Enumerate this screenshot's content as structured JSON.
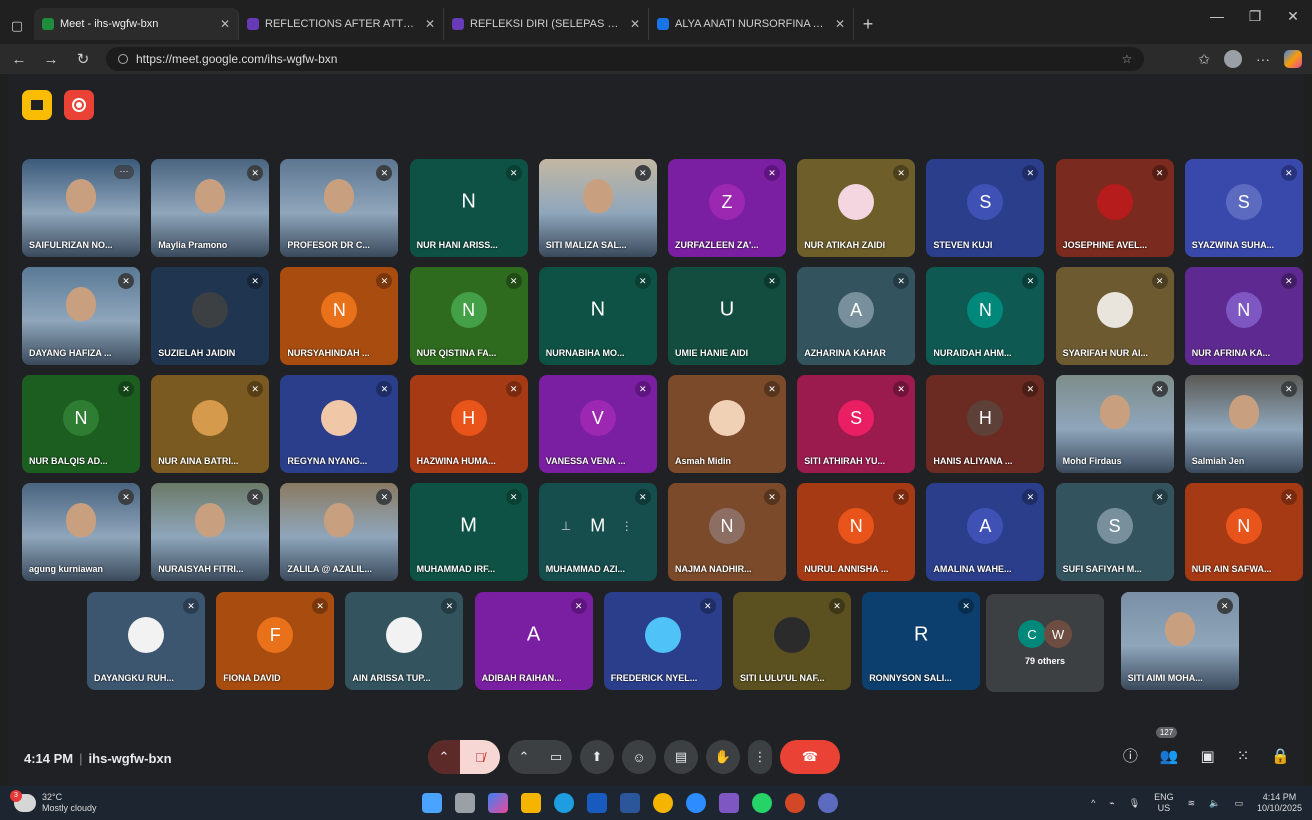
{
  "browser": {
    "tabs": [
      {
        "title": "Meet - ihs-wgfw-bxn",
        "active": true,
        "color": "#1e8e3e"
      },
      {
        "title": "REFLECTIONS AFTER ATTENDING",
        "active": false,
        "color": "#673ab7"
      },
      {
        "title": "REFLEKSI DIRI (SELEPAS MENGHA",
        "active": false,
        "color": "#673ab7"
      },
      {
        "title": "ALYA ANATI NURSORFINA ABDUL",
        "active": false,
        "color": "#1a73e8"
      }
    ],
    "url": "https://meet.google.com/ihs-wgfw-bxn"
  },
  "participants": [
    {
      "name": "SAIFULRIZAN NO...",
      "initial": "",
      "bg": "#3b5a7a",
      "type": "photo",
      "mic": "more",
      "micColor": "#3c4043"
    },
    {
      "name": "Maylia Pramono",
      "initial": "",
      "bg": "#4a6480",
      "type": "photo",
      "mic": "off",
      "micColor": "#3c4043"
    },
    {
      "name": "PROFESOR DR C...",
      "initial": "",
      "bg": "#5d7691",
      "type": "photo",
      "mic": "off",
      "micColor": "#3c4043"
    },
    {
      "name": "NUR HANI ARISS...",
      "initial": "N",
      "bg": "#0d5244",
      "type": "letter",
      "mic": "off",
      "micColor": "#0a3f34"
    },
    {
      "name": "SITI MALIZA SAL...",
      "initial": "",
      "bg": "#c3b7a3",
      "type": "photo",
      "mic": "off",
      "micColor": "#3c4043"
    },
    {
      "name": "ZURFAZLEEN ZA'...",
      "initial": "Z",
      "bg": "#7b1fa2",
      "type": "avatar",
      "avatarBg": "#9c27b0",
      "mic": "off",
      "micColor": "#5e1580"
    },
    {
      "name": "NUR ATIKAH ZAIDI",
      "initial": "",
      "bg": "#6d5e2a",
      "type": "avatar",
      "avatarBg": "#f3d6e0",
      "mic": "off",
      "micColor": "#4c411c"
    },
    {
      "name": "STEVEN KUJI",
      "initial": "S",
      "bg": "#2b3e8c",
      "type": "avatar",
      "avatarBg": "#3f51b5",
      "mic": "off",
      "micColor": "#1f2d66"
    },
    {
      "name": "JOSEPHINE AVEL...",
      "initial": "",
      "bg": "#7a2a1e",
      "type": "avatar",
      "avatarBg": "#b71c1c",
      "mic": "off",
      "micColor": "#561d15"
    },
    {
      "name": "SYAZWINA SUHA...",
      "initial": "S",
      "bg": "#3949ab",
      "type": "avatar",
      "avatarBg": "#5c6bc0",
      "mic": "off",
      "micColor": "#283380"
    },
    {
      "name": "DAYANG HAFIZA ...",
      "initial": "",
      "bg": "#5a7a96",
      "type": "photo",
      "mic": "off",
      "micColor": "#3c4043"
    },
    {
      "name": "SUZIELAH JAIDIN",
      "initial": "",
      "bg": "#1f3550",
      "type": "avatar",
      "avatarBg": "#3c4043",
      "mic": "off",
      "micColor": "#162638"
    },
    {
      "name": "NURSYAHINDAH ...",
      "initial": "N",
      "bg": "#a84c10",
      "type": "avatar",
      "avatarBg": "#e8711a",
      "mic": "off",
      "micColor": "#7a370c"
    },
    {
      "name": "NUR QISTINA FA...",
      "initial": "N",
      "bg": "#2e6b1e",
      "type": "avatar",
      "avatarBg": "#43a047",
      "mic": "off",
      "micColor": "#204b15"
    },
    {
      "name": "NURNABIHA MO...",
      "initial": "N",
      "bg": "#0d5244",
      "type": "letter",
      "mic": "off",
      "micColor": "#0a3f34"
    },
    {
      "name": "UMIE HANIE AIDI",
      "initial": "U",
      "bg": "#124d3f",
      "type": "letter",
      "mic": "off",
      "micColor": "#0c392e"
    },
    {
      "name": "AZHARINA KAHAR",
      "initial": "A",
      "bg": "#33545f",
      "type": "avatar",
      "avatarBg": "#78909c",
      "mic": "off",
      "micColor": "#233b43"
    },
    {
      "name": "NURAIDAH AHM...",
      "initial": "N",
      "bg": "#0f5953",
      "type": "avatar",
      "avatarBg": "#00897b",
      "mic": "off",
      "micColor": "#0a3f3b"
    },
    {
      "name": "SYARIFAH NUR AI...",
      "initial": "",
      "bg": "#6d5a30",
      "type": "avatar",
      "avatarBg": "#e9e4dc",
      "mic": "off",
      "micColor": "#4d3f22"
    },
    {
      "name": "NUR AFRINA KA...",
      "initial": "N",
      "bg": "#5e2a91",
      "type": "avatar",
      "avatarBg": "#7e57c2",
      "mic": "off",
      "micColor": "#431e67"
    },
    {
      "name": "NUR BALQIS AD...",
      "initial": "N",
      "bg": "#1b5e20",
      "type": "avatar",
      "avatarBg": "#2e7d32",
      "mic": "off",
      "micColor": "#134417"
    },
    {
      "name": "NUR AINA BATRI...",
      "initial": "",
      "bg": "#7a5a20",
      "type": "avatar",
      "avatarBg": "#d59a4c",
      "mic": "off",
      "micColor": "#563f17"
    },
    {
      "name": "REGYNA NYANG...",
      "initial": "",
      "bg": "#2b3e8c",
      "type": "avatar",
      "avatarBg": "#f0c8a8",
      "mic": "off",
      "micColor": "#1f2d66"
    },
    {
      "name": "HAZWINA HUMA...",
      "initial": "H",
      "bg": "#a63a14",
      "type": "avatar",
      "avatarBg": "#e8541a",
      "mic": "off",
      "micColor": "#7a2b0f"
    },
    {
      "name": "VANESSA VENA ...",
      "initial": "V",
      "bg": "#7b1fa2",
      "type": "avatar",
      "avatarBg": "#9c27b0",
      "mic": "off",
      "micColor": "#5e1580"
    },
    {
      "name": "Asmah Midin",
      "initial": "",
      "bg": "#7a4a2a",
      "type": "avatar",
      "avatarBg": "#f1d1b6",
      "mic": "off",
      "micColor": "#56341e"
    },
    {
      "name": "SITI ATHIRAH YU...",
      "initial": "S",
      "bg": "#9c1b4f",
      "type": "avatar",
      "avatarBg": "#e91e63",
      "mic": "off",
      "micColor": "#701338"
    },
    {
      "name": "HANIS ALIYANA ...",
      "initial": "H",
      "bg": "#6b2a22",
      "type": "avatar",
      "avatarBg": "#5d4037",
      "mic": "off",
      "micColor": "#4c1e18"
    },
    {
      "name": "Mohd Firdaus",
      "initial": "",
      "bg": "#7d8d8a",
      "type": "photo",
      "mic": "off",
      "micColor": "#3c4043"
    },
    {
      "name": "Salmiah Jen",
      "initial": "",
      "bg": "#5b5a55",
      "type": "photo",
      "mic": "off",
      "micColor": "#3c4043"
    },
    {
      "name": "agung kurniawan",
      "initial": "",
      "bg": "#4a6480",
      "type": "photo",
      "mic": "off",
      "micColor": "#3c4043"
    },
    {
      "name": "NURAISYAH FITRI...",
      "initial": "",
      "bg": "#6b7a68",
      "type": "photo",
      "mic": "off",
      "micColor": "#3c4043"
    },
    {
      "name": "ZALILA @ AZALIL...",
      "initial": "",
      "bg": "#8a7a62",
      "type": "photo",
      "mic": "off",
      "micColor": "#3c4043"
    },
    {
      "name": "MUHAMMAD IRF...",
      "initial": "M",
      "bg": "#0d5244",
      "type": "letter",
      "mic": "off",
      "micColor": "#0a3f34"
    },
    {
      "name": "MUHAMMAD AZI...",
      "initial": "M",
      "bg": "#164e4e",
      "type": "pinned",
      "mic": "off",
      "micColor": "#0f3838"
    },
    {
      "name": "NAJMA NADHIR...",
      "initial": "N",
      "bg": "#7a4a2a",
      "type": "avatar",
      "avatarBg": "#8d6e63",
      "mic": "off",
      "micColor": "#56341e"
    },
    {
      "name": "NURUL ANNISHA ...",
      "initial": "N",
      "bg": "#a63a14",
      "type": "avatar",
      "avatarBg": "#e8541a",
      "mic": "off",
      "micColor": "#7a2b0f"
    },
    {
      "name": "AMALINA WAHE...",
      "initial": "A",
      "bg": "#2b3e8c",
      "type": "avatar",
      "avatarBg": "#3f51b5",
      "mic": "off",
      "micColor": "#1f2d66"
    },
    {
      "name": "SUFI SAFIYAH M...",
      "initial": "S",
      "bg": "#33545f",
      "type": "avatar",
      "avatarBg": "#78909c",
      "mic": "off",
      "micColor": "#233b43"
    },
    {
      "name": "NUR AIN SAFWA...",
      "initial": "N",
      "bg": "#a63a14",
      "type": "avatar",
      "avatarBg": "#e8541a",
      "mic": "off",
      "micColor": "#7a2b0f"
    },
    {
      "name": "DAYANGKU RUH...",
      "initial": "",
      "bg": "#3d5670",
      "type": "avatar",
      "avatarBg": "#f2f2f2",
      "mic": "off",
      "micColor": "#2b3d50"
    },
    {
      "name": "FIONA DAVID",
      "initial": "F",
      "bg": "#a84c10",
      "type": "avatar",
      "avatarBg": "#e8711a",
      "mic": "off",
      "micColor": "#7a370c"
    },
    {
      "name": "AIN ARISSA TUP...",
      "initial": "",
      "bg": "#33545f",
      "type": "avatar",
      "avatarBg": "#f2f2f2",
      "mic": "off",
      "micColor": "#233b43"
    },
    {
      "name": "ADIBAH RAIHAN...",
      "initial": "A",
      "bg": "#7b1fa2",
      "type": "letter",
      "mic": "off",
      "micColor": "#5e1580"
    },
    {
      "name": "FREDERICK NYEL...",
      "initial": "",
      "bg": "#2b3e8c",
      "type": "avatar",
      "avatarBg": "#4fc3f7",
      "mic": "off",
      "micColor": "#1f2d66"
    },
    {
      "name": "SITI LULU'UL NAF...",
      "initial": "",
      "bg": "#5a5020",
      "type": "avatar",
      "avatarBg": "#2b2b2b",
      "mic": "off",
      "micColor": "#3f3816"
    },
    {
      "name": "RONNYSON SALI...",
      "initial": "R",
      "bg": "#0d3f6e",
      "type": "letter",
      "mic": "off",
      "micColor": "#092d4f"
    },
    {
      "name": "SITI AIMI MOHA...",
      "initial": "",
      "bg": "#7a8fa5",
      "type": "photo",
      "mic": "off",
      "micColor": "#3c4043"
    }
  ],
  "others": {
    "label": "79 others",
    "c1": "C",
    "c2": "W",
    "c1Color": "#00897b",
    "c2Color": "#6d4c41"
  },
  "meeting": {
    "time": "4:14 PM",
    "code": "ihs-wgfw-bxn",
    "people_count": "127"
  },
  "taskbar": {
    "temp": "32°C",
    "condition": "Mostly cloudy",
    "badge": "3",
    "lang": "ENG",
    "region": "US",
    "time": "4:14 PM",
    "date": "10/10/2025"
  }
}
